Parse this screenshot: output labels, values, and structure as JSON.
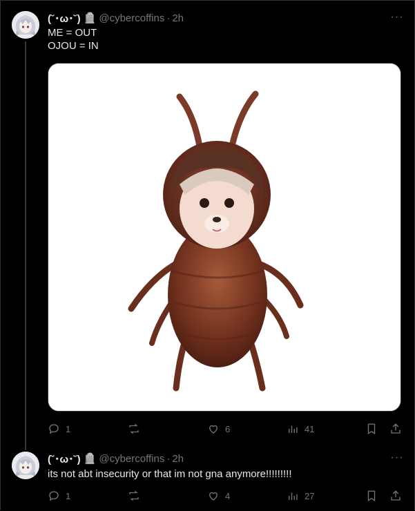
{
  "tweets": [
    {
      "display_name": "(˘･ω･˘)",
      "badge": "🪦",
      "handle": "@cybercoffins",
      "separator": "·",
      "time": "2h",
      "more": "···",
      "text": "ME = OUT\nOJOU = IN",
      "stats": {
        "replies": "1",
        "reposts": "",
        "likes": "6",
        "views": "41"
      }
    },
    {
      "display_name": "(˘･ω･˘)",
      "badge": "🪦",
      "handle": "@cybercoffins",
      "separator": "·",
      "time": "2h",
      "more": "···",
      "text": "its not abt insecurity or that im not gna anymore!!!!!!!!!",
      "stats": {
        "replies": "1",
        "reposts": "",
        "likes": "4",
        "views": "27"
      }
    }
  ],
  "colors": {
    "background": "#000000",
    "text_primary": "#e7e9ea",
    "text_secondary": "#71767b",
    "border": "#2f3336"
  },
  "icons": {
    "reply": "reply-icon",
    "repost": "repost-icon",
    "like": "like-icon",
    "views": "views-icon",
    "bookmark": "bookmark-icon",
    "share": "share-icon",
    "more": "more-icon",
    "badge": "tombstone-emoji"
  }
}
